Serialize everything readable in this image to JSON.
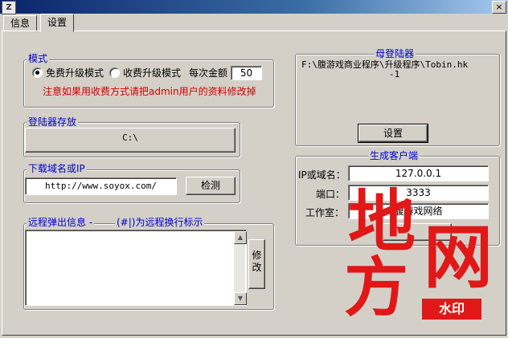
{
  "window": {
    "icon_text": "Z",
    "close_glyph": "×"
  },
  "tabs": [
    {
      "label": "信息"
    },
    {
      "label": "设置"
    }
  ],
  "mode": {
    "legend": "模式",
    "options": [
      {
        "label": "免费升级模式",
        "selected": true
      },
      {
        "label": "收费升级模式",
        "selected": false
      }
    ],
    "amount_label": "每次金额",
    "amount_value": "50",
    "warning": "注意如果用收费方式请把admin用户的资料修改掉"
  },
  "storage": {
    "legend": "登陆器存放",
    "path": "C:\\"
  },
  "download": {
    "legend": "下载域名或IP",
    "url": "http://www.soyox.com/",
    "check_button": "检测"
  },
  "remote": {
    "legend": "远程弹出信息 -",
    "hint": "(#|)为远程换行标示",
    "text": "",
    "modify_button": "修改"
  },
  "master": {
    "legend": "母登陆器",
    "path_line1": "F:\\腹游戏商业程序\\升级程序\\Tobin.hk",
    "path_line2": "-1",
    "settings_button": "设置"
  },
  "client": {
    "legend": "生成客户端",
    "ip_label": "IP或域名：",
    "ip_value": "127.0.0.1",
    "port_label": "端口：",
    "port_value": "3333",
    "studio_label": "工作室：",
    "studio_value": "腹游戏网络"
  },
  "watermark": {
    "chars": [
      "地",
      "方",
      "网"
    ],
    "stamp": "水印",
    "color": "#e01818"
  }
}
